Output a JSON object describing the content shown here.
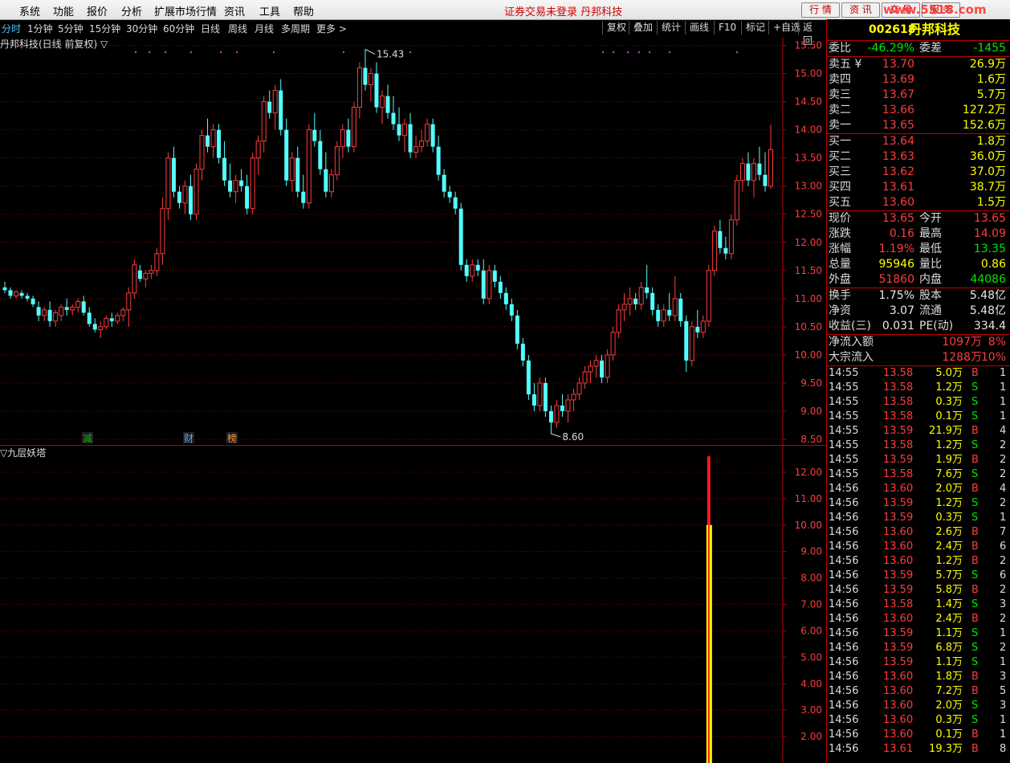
{
  "menu": {
    "items": [
      "系统",
      "功能",
      "报价",
      "分析",
      "扩展市场行情",
      "资讯",
      "工具",
      "帮助"
    ],
    "notice": "证券交易未登录  丹邦科技",
    "quick_buttons": [
      "行 情",
      "资 讯",
      "交 易",
      "服 务"
    ],
    "watermark_url": "www.5518.com"
  },
  "periods": [
    "分时",
    "1分钟",
    "5分钟",
    "15分钟",
    "30分钟",
    "60分钟",
    "日线",
    "周线",
    "月线",
    "多周期",
    "更多 >"
  ],
  "active_period": "分时",
  "tools": [
    "复权",
    "叠加",
    "统计",
    "画线",
    "F10",
    "标记",
    "+自选",
    "返回"
  ],
  "chart_title": "丹邦科技(日线 前复权) ▽",
  "sub_title": "▽九层妖塔",
  "colors": {
    "up": "#ff3c3c",
    "down": "#54ffff",
    "grid": "#8b0000",
    "axis": "#c00000",
    "indicator_red": "#ff1a1a",
    "indicator_yellow": "#ffff00"
  },
  "chart_data": [
    {
      "type": "candlestick",
      "ylim": [
        8.4,
        15.65
      ],
      "y_ticks": [
        "15.50",
        "15.00",
        "14.50",
        "14.00",
        "13.50",
        "13.00",
        "12.50",
        "12.00",
        "11.50",
        "11.00",
        "10.50",
        "10.00",
        "9.50",
        "9.00",
        "8.50"
      ],
      "annotations": {
        "high": "15.43",
        "low": "8.60"
      },
      "event_markers": [
        "减",
        "财",
        "榜"
      ],
      "candles": [
        [
          11.2,
          11.3,
          11.1,
          11.15
        ],
        [
          11.15,
          11.2,
          11.0,
          11.05
        ],
        [
          11.05,
          11.15,
          11.0,
          11.12
        ],
        [
          11.1,
          11.15,
          11.0,
          11.05
        ],
        [
          11.05,
          11.1,
          10.95,
          11.0
        ],
        [
          11.0,
          11.05,
          10.85,
          10.9
        ],
        [
          10.85,
          10.95,
          10.6,
          10.7
        ],
        [
          10.7,
          10.85,
          10.6,
          10.8
        ],
        [
          10.8,
          10.95,
          10.5,
          10.6
        ],
        [
          10.6,
          10.8,
          10.5,
          10.75
        ],
        [
          10.7,
          10.9,
          10.6,
          10.85
        ],
        [
          10.85,
          11.0,
          10.7,
          10.8
        ],
        [
          10.8,
          10.9,
          10.7,
          10.85
        ],
        [
          10.85,
          11.0,
          10.75,
          10.95
        ],
        [
          10.95,
          11.05,
          10.7,
          10.75
        ],
        [
          10.75,
          10.85,
          10.5,
          10.55
        ],
        [
          10.55,
          10.65,
          10.4,
          10.45
        ],
        [
          10.45,
          10.6,
          10.3,
          10.5
        ],
        [
          10.5,
          10.7,
          10.45,
          10.65
        ],
        [
          10.65,
          10.75,
          10.5,
          10.6
        ],
        [
          10.6,
          10.75,
          10.55,
          10.7
        ],
        [
          10.7,
          10.85,
          10.6,
          10.8
        ],
        [
          10.8,
          11.2,
          10.5,
          11.1
        ],
        [
          11.1,
          11.7,
          11.0,
          11.6
        ],
        [
          11.5,
          11.6,
          11.3,
          11.35
        ],
        [
          11.35,
          11.5,
          11.2,
          11.45
        ],
        [
          11.45,
          11.6,
          11.35,
          11.5
        ],
        [
          11.5,
          11.9,
          11.4,
          11.8
        ],
        [
          11.8,
          12.8,
          11.6,
          12.6
        ],
        [
          12.6,
          13.6,
          12.4,
          13.5
        ],
        [
          13.5,
          13.7,
          12.8,
          12.9
        ],
        [
          12.9,
          13.0,
          12.6,
          12.7
        ],
        [
          12.7,
          13.1,
          12.5,
          13.0
        ],
        [
          13.0,
          13.2,
          12.4,
          12.5
        ],
        [
          12.5,
          13.4,
          12.4,
          13.3
        ],
        [
          13.3,
          14.0,
          13.1,
          13.9
        ],
        [
          13.9,
          14.2,
          13.6,
          13.7
        ],
        [
          13.7,
          14.1,
          13.5,
          14.0
        ],
        [
          14.0,
          14.1,
          13.4,
          13.5
        ],
        [
          13.5,
          13.8,
          13.0,
          13.1
        ],
        [
          13.1,
          13.4,
          12.8,
          12.9
        ],
        [
          12.9,
          13.2,
          12.7,
          13.1
        ],
        [
          13.1,
          13.3,
          12.9,
          13.0
        ],
        [
          13.0,
          13.2,
          12.5,
          12.6
        ],
        [
          12.6,
          13.6,
          12.5,
          13.5
        ],
        [
          13.5,
          13.9,
          13.2,
          13.8
        ],
        [
          13.8,
          14.6,
          13.6,
          14.5
        ],
        [
          14.5,
          14.7,
          14.2,
          14.3
        ],
        [
          14.3,
          14.8,
          14.0,
          14.7
        ],
        [
          14.7,
          14.9,
          13.9,
          14.0
        ],
        [
          14.0,
          14.2,
          13.0,
          13.1
        ],
        [
          13.1,
          13.6,
          12.9,
          13.5
        ],
        [
          13.5,
          13.7,
          12.8,
          12.9
        ],
        [
          12.9,
          13.2,
          12.6,
          12.7
        ],
        [
          12.7,
          14.1,
          12.6,
          14.0
        ],
        [
          14.0,
          14.3,
          13.7,
          13.8
        ],
        [
          13.8,
          14.0,
          13.2,
          13.3
        ],
        [
          13.3,
          13.6,
          12.8,
          12.9
        ],
        [
          12.9,
          13.3,
          12.8,
          13.2
        ],
        [
          13.2,
          13.8,
          13.1,
          13.7
        ],
        [
          13.7,
          14.1,
          13.5,
          14.0
        ],
        [
          14.0,
          14.2,
          13.6,
          13.7
        ],
        [
          13.7,
          14.5,
          13.6,
          14.4
        ],
        [
          14.4,
          15.2,
          14.2,
          15.1
        ],
        [
          15.1,
          15.43,
          14.7,
          14.8
        ],
        [
          14.8,
          15.1,
          14.5,
          15.0
        ],
        [
          15.0,
          15.2,
          14.3,
          14.4
        ],
        [
          14.4,
          14.7,
          14.1,
          14.6
        ],
        [
          14.6,
          14.8,
          14.2,
          14.3
        ],
        [
          14.3,
          14.6,
          14.0,
          14.1
        ],
        [
          14.1,
          14.4,
          13.8,
          13.9
        ],
        [
          13.9,
          14.2,
          13.6,
          14.1
        ],
        [
          14.1,
          14.3,
          13.5,
          13.6
        ],
        [
          13.6,
          13.9,
          13.5,
          13.7
        ],
        [
          13.7,
          14.0,
          13.6,
          13.8
        ],
        [
          13.8,
          14.2,
          13.7,
          14.1
        ],
        [
          14.1,
          14.2,
          13.6,
          13.7
        ],
        [
          13.7,
          13.9,
          13.1,
          13.2
        ],
        [
          13.2,
          13.3,
          12.8,
          12.9
        ],
        [
          12.9,
          13.0,
          12.7,
          12.8
        ],
        [
          12.8,
          12.9,
          12.5,
          12.6
        ],
        [
          12.6,
          12.7,
          11.5,
          11.6
        ],
        [
          11.6,
          11.7,
          11.3,
          11.4
        ],
        [
          11.4,
          11.7,
          11.3,
          11.6
        ],
        [
          11.6,
          11.7,
          11.4,
          11.5
        ],
        [
          11.5,
          11.7,
          10.9,
          11.0
        ],
        [
          11.0,
          11.6,
          10.9,
          11.5
        ],
        [
          11.5,
          11.6,
          11.2,
          11.3
        ],
        [
          11.3,
          11.4,
          11.0,
          11.1
        ],
        [
          11.1,
          11.2,
          10.8,
          10.9
        ],
        [
          10.9,
          11.0,
          10.6,
          10.7
        ],
        [
          10.7,
          10.8,
          10.1,
          10.2
        ],
        [
          10.2,
          10.3,
          9.8,
          9.9
        ],
        [
          9.9,
          10.0,
          9.2,
          9.3
        ],
        [
          9.3,
          9.5,
          9.0,
          9.1
        ],
        [
          9.1,
          9.6,
          9.0,
          9.5
        ],
        [
          9.5,
          9.6,
          8.9,
          9.0
        ],
        [
          9.0,
          9.1,
          8.6,
          8.8
        ],
        [
          8.8,
          9.2,
          8.7,
          9.1
        ],
        [
          9.1,
          9.3,
          8.9,
          9.0
        ],
        [
          9.0,
          9.3,
          8.8,
          9.2
        ],
        [
          9.2,
          9.4,
          9.0,
          9.3
        ],
        [
          9.3,
          9.6,
          9.2,
          9.5
        ],
        [
          9.5,
          9.8,
          9.4,
          9.7
        ],
        [
          9.7,
          9.9,
          9.5,
          9.8
        ],
        [
          9.8,
          10.0,
          9.6,
          9.9
        ],
        [
          9.9,
          10.0,
          9.5,
          9.6
        ],
        [
          9.6,
          10.1,
          9.5,
          10.0
        ],
        [
          10.0,
          10.5,
          9.9,
          10.4
        ],
        [
          10.4,
          10.9,
          10.3,
          10.8
        ],
        [
          10.8,
          11.1,
          10.6,
          10.9
        ],
        [
          10.9,
          11.2,
          10.7,
          11.0
        ],
        [
          11.0,
          11.1,
          10.8,
          10.9
        ],
        [
          10.9,
          11.3,
          10.8,
          11.2
        ],
        [
          11.2,
          11.6,
          11.0,
          11.1
        ],
        [
          11.1,
          11.2,
          10.7,
          10.8
        ],
        [
          10.8,
          10.9,
          10.5,
          10.6
        ],
        [
          10.6,
          10.9,
          10.5,
          10.8
        ],
        [
          10.8,
          11.1,
          10.6,
          10.7
        ],
        [
          10.7,
          11.4,
          10.6,
          11.0
        ],
        [
          11.0,
          11.1,
          10.5,
          10.6
        ],
        [
          10.6,
          10.7,
          9.7,
          9.9
        ],
        [
          9.9,
          10.6,
          9.8,
          10.5
        ],
        [
          10.5,
          10.8,
          10.3,
          10.4
        ],
        [
          10.4,
          10.7,
          10.3,
          10.6
        ],
        [
          10.6,
          11.6,
          10.5,
          11.5
        ],
        [
          11.5,
          12.3,
          11.4,
          12.2
        ],
        [
          12.2,
          12.4,
          11.8,
          11.9
        ],
        [
          11.9,
          12.1,
          11.7,
          11.8
        ],
        [
          11.8,
          12.5,
          11.7,
          12.4
        ],
        [
          12.4,
          13.2,
          12.3,
          13.1
        ],
        [
          13.1,
          13.5,
          12.9,
          13.4
        ],
        [
          13.4,
          13.6,
          13.0,
          13.1
        ],
        [
          13.1,
          13.5,
          12.8,
          13.4
        ],
        [
          13.4,
          13.7,
          13.1,
          13.2
        ],
        [
          13.2,
          13.6,
          12.9,
          13.0
        ],
        [
          13.0,
          14.09,
          12.95,
          13.65
        ]
      ]
    },
    {
      "type": "bar",
      "name": "九层妖塔",
      "ylim": [
        1.0,
        13.0
      ],
      "y_ticks": [
        "12.00",
        "11.00",
        "10.00",
        "9.00",
        "8.00",
        "7.00",
        "6.00",
        "5.00",
        "4.00",
        "3.00",
        "2.00"
      ],
      "bars": [
        {
          "index": 125,
          "red_to": 12.6,
          "yellow_to": 10.0
        }
      ]
    }
  ],
  "panel": {
    "code": "002618",
    "name": "丹邦科技",
    "weibi": {
      "l1": "委比",
      "v1": "-46.29%",
      "l2": "委差",
      "v2": "-1455"
    },
    "asks": [
      {
        "label": "卖五 ¥",
        "price": "13.70",
        "vol": "26.9万"
      },
      {
        "label": "卖四",
        "price": "13.69",
        "vol": "1.6万"
      },
      {
        "label": "卖三",
        "price": "13.67",
        "vol": "5.7万"
      },
      {
        "label": "卖二",
        "price": "13.66",
        "vol": "127.2万"
      },
      {
        "label": "卖一",
        "price": "13.65",
        "vol": "152.6万"
      }
    ],
    "bids": [
      {
        "label": "买一",
        "price": "13.64",
        "vol": "1.8万"
      },
      {
        "label": "买二",
        "price": "13.63",
        "vol": "36.0万"
      },
      {
        "label": "买三",
        "price": "13.62",
        "vol": "37.0万"
      },
      {
        "label": "买四",
        "price": "13.61",
        "vol": "38.7万"
      },
      {
        "label": "买五",
        "price": "13.60",
        "vol": "1.5万"
      }
    ],
    "quote": [
      {
        "l1": "现价",
        "v1": "13.65",
        "c1": "red",
        "l2": "今开",
        "v2": "13.65",
        "c2": "red"
      },
      {
        "l1": "涨跌",
        "v1": "0.16",
        "c1": "red",
        "l2": "最高",
        "v2": "14.09",
        "c2": "red"
      },
      {
        "l1": "涨幅",
        "v1": "1.19%",
        "c1": "red",
        "l2": "最低",
        "v2": "13.35",
        "c2": "green"
      },
      {
        "l1": "总量",
        "v1": "95946",
        "c1": "yellow",
        "l2": "量比",
        "v2": "0.86",
        "c2": "yellow"
      },
      {
        "l1": "外盘",
        "v1": "51860",
        "c1": "red",
        "l2": "内盘",
        "v2": "44086",
        "c2": "green"
      }
    ],
    "fund": [
      {
        "l1": "换手",
        "v1": "1.75%",
        "l2": "股本",
        "v2": "5.48亿"
      },
      {
        "l1": "净资",
        "v1": "3.07",
        "l2": "流通",
        "v2": "5.48亿"
      },
      {
        "l1": "收益(三)",
        "v1": "0.031",
        "l2": "PE(动)",
        "v2": "334.4"
      }
    ],
    "flow": [
      {
        "label": "净流入额",
        "value": "1097万",
        "pct": "8%"
      },
      {
        "label": "大宗流入",
        "value": "1288万",
        "pct": "10%"
      }
    ],
    "ticks": [
      {
        "t": "14:55",
        "p": "13.58",
        "v": "5.0万",
        "bs": "B",
        "n": "1"
      },
      {
        "t": "14:55",
        "p": "13.58",
        "v": "1.2万",
        "bs": "S",
        "n": "1"
      },
      {
        "t": "14:55",
        "p": "13.58",
        "v": "0.3万",
        "bs": "S",
        "n": "1"
      },
      {
        "t": "14:55",
        "p": "13.58",
        "v": "0.1万",
        "bs": "S",
        "n": "1"
      },
      {
        "t": "14:55",
        "p": "13.59",
        "v": "21.9万",
        "bs": "B",
        "n": "4"
      },
      {
        "t": "14:55",
        "p": "13.58",
        "v": "1.2万",
        "bs": "S",
        "n": "2"
      },
      {
        "t": "14:55",
        "p": "13.59",
        "v": "1.9万",
        "bs": "B",
        "n": "2"
      },
      {
        "t": "14:55",
        "p": "13.58",
        "v": "7.6万",
        "bs": "S",
        "n": "2"
      },
      {
        "t": "14:56",
        "p": "13.60",
        "v": "2.0万",
        "bs": "B",
        "n": "4"
      },
      {
        "t": "14:56",
        "p": "13.59",
        "v": "1.2万",
        "bs": "S",
        "n": "2"
      },
      {
        "t": "14:56",
        "p": "13.59",
        "v": "0.3万",
        "bs": "S",
        "n": "1"
      },
      {
        "t": "14:56",
        "p": "13.60",
        "v": "2.6万",
        "bs": "B",
        "n": "7"
      },
      {
        "t": "14:56",
        "p": "13.60",
        "v": "2.4万",
        "bs": "B",
        "n": "6"
      },
      {
        "t": "14:56",
        "p": "13.60",
        "v": "1.2万",
        "bs": "B",
        "n": "2"
      },
      {
        "t": "14:56",
        "p": "13.59",
        "v": "5.7万",
        "bs": "S",
        "n": "6"
      },
      {
        "t": "14:56",
        "p": "13.59",
        "v": "5.8万",
        "bs": "B",
        "n": "2"
      },
      {
        "t": "14:56",
        "p": "13.58",
        "v": "1.4万",
        "bs": "S",
        "n": "3"
      },
      {
        "t": "14:56",
        "p": "13.60",
        "v": "2.4万",
        "bs": "B",
        "n": "2"
      },
      {
        "t": "14:56",
        "p": "13.59",
        "v": "1.1万",
        "bs": "S",
        "n": "1"
      },
      {
        "t": "14:56",
        "p": "13.59",
        "v": "6.8万",
        "bs": "S",
        "n": "2"
      },
      {
        "t": "14:56",
        "p": "13.59",
        "v": "1.1万",
        "bs": "S",
        "n": "1"
      },
      {
        "t": "14:56",
        "p": "13.60",
        "v": "1.8万",
        "bs": "B",
        "n": "3"
      },
      {
        "t": "14:56",
        "p": "13.60",
        "v": "7.2万",
        "bs": "B",
        "n": "5"
      },
      {
        "t": "14:56",
        "p": "13.60",
        "v": "2.0万",
        "bs": "S",
        "n": "3"
      },
      {
        "t": "14:56",
        "p": "13.60",
        "v": "0.3万",
        "bs": "S",
        "n": "1"
      },
      {
        "t": "14:56",
        "p": "13.60",
        "v": "0.1万",
        "bs": "B",
        "n": "1"
      },
      {
        "t": "14:56",
        "p": "13.61",
        "v": "19.3万",
        "bs": "B",
        "n": "8"
      }
    ]
  }
}
